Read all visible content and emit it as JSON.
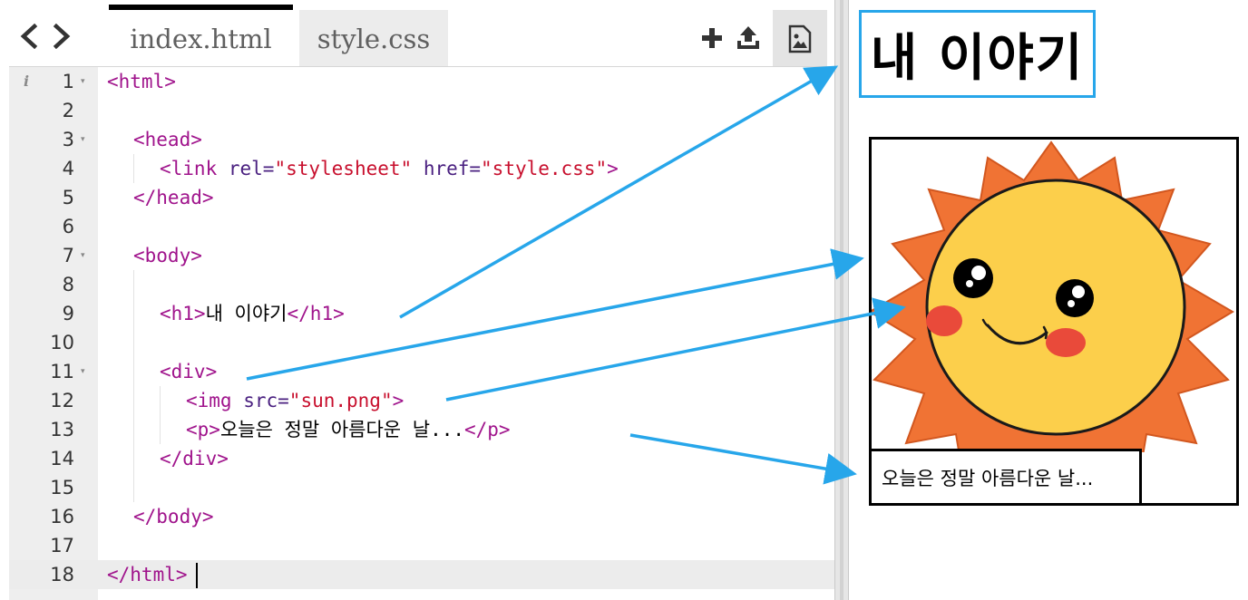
{
  "editor": {
    "tabs": [
      {
        "label": "index.html",
        "active": true
      },
      {
        "label": "style.css",
        "active": false
      }
    ],
    "toolbar": {
      "back_icon": "chevron-left-icon",
      "forward_icon": "chevron-right-icon",
      "add_icon": "plus-icon",
      "upload_icon": "upload-icon",
      "image_icon": "image-icon"
    },
    "active_line": 18,
    "lines": [
      {
        "num": "1",
        "fold": true,
        "info": true,
        "indent": 0,
        "tokens": [
          {
            "t": "tag",
            "v": "<html>"
          }
        ]
      },
      {
        "num": "2",
        "fold": false,
        "indent": 0,
        "tokens": []
      },
      {
        "num": "3",
        "fold": true,
        "indent": 1,
        "tokens": [
          {
            "t": "tag",
            "v": "<head>"
          }
        ]
      },
      {
        "num": "4",
        "fold": false,
        "indent": 2,
        "tokens": [
          {
            "t": "tag",
            "v": "<link "
          },
          {
            "t": "attr",
            "v": "rel="
          },
          {
            "t": "str",
            "v": "\"stylesheet\""
          },
          {
            "t": "plain",
            "v": " "
          },
          {
            "t": "attr",
            "v": "href="
          },
          {
            "t": "str",
            "v": "\"style.css\""
          },
          {
            "t": "tag",
            "v": ">"
          }
        ]
      },
      {
        "num": "5",
        "fold": false,
        "indent": 1,
        "tokens": [
          {
            "t": "tag",
            "v": "</head>"
          }
        ]
      },
      {
        "num": "6",
        "fold": false,
        "indent": 0,
        "tokens": []
      },
      {
        "num": "7",
        "fold": true,
        "indent": 1,
        "tokens": [
          {
            "t": "tag",
            "v": "<body>"
          }
        ]
      },
      {
        "num": "8",
        "fold": false,
        "indent": 0,
        "tokens": []
      },
      {
        "num": "9",
        "fold": false,
        "indent": 2,
        "tokens": [
          {
            "t": "tag",
            "v": "<h1>"
          },
          {
            "t": "plain",
            "v": "내 이야기"
          },
          {
            "t": "tag",
            "v": "</h1>"
          }
        ]
      },
      {
        "num": "10",
        "fold": false,
        "indent": 0,
        "tokens": []
      },
      {
        "num": "11",
        "fold": true,
        "indent": 2,
        "tokens": [
          {
            "t": "tag",
            "v": "<div>"
          }
        ]
      },
      {
        "num": "12",
        "fold": false,
        "indent": 3,
        "tokens": [
          {
            "t": "tag",
            "v": "<img "
          },
          {
            "t": "attr",
            "v": "src="
          },
          {
            "t": "str",
            "v": "\"sun.png\""
          },
          {
            "t": "tag",
            "v": ">"
          }
        ]
      },
      {
        "num": "13",
        "fold": false,
        "indent": 3,
        "tokens": [
          {
            "t": "tag",
            "v": "<p>"
          },
          {
            "t": "plain",
            "v": "오늘은 정말 아름다운 날..."
          },
          {
            "t": "tag",
            "v": "</p>"
          }
        ]
      },
      {
        "num": "14",
        "fold": false,
        "indent": 2,
        "tokens": [
          {
            "t": "tag",
            "v": "</div>"
          }
        ]
      },
      {
        "num": "15",
        "fold": false,
        "indent": 0,
        "tokens": []
      },
      {
        "num": "16",
        "fold": false,
        "indent": 1,
        "tokens": [
          {
            "t": "tag",
            "v": "</body>"
          }
        ]
      },
      {
        "num": "17",
        "fold": false,
        "indent": 0,
        "tokens": []
      },
      {
        "num": "18",
        "fold": false,
        "indent": 0,
        "tokens": [
          {
            "t": "tag",
            "v": "</html>"
          }
        ]
      }
    ]
  },
  "preview": {
    "heading": "내 이야기",
    "paragraph": "오늘은 정말 아름다운 날...",
    "image_icon": "sun-image"
  },
  "colors": {
    "tag": "#a0148c",
    "attribute": "#4a2080",
    "string": "#c8102e",
    "arrow": "#27a6ea",
    "h1_border": "#27a6ea",
    "sun_rays": "#f07334",
    "sun_face": "#fccf4b",
    "cheeks": "#e94a3a"
  }
}
